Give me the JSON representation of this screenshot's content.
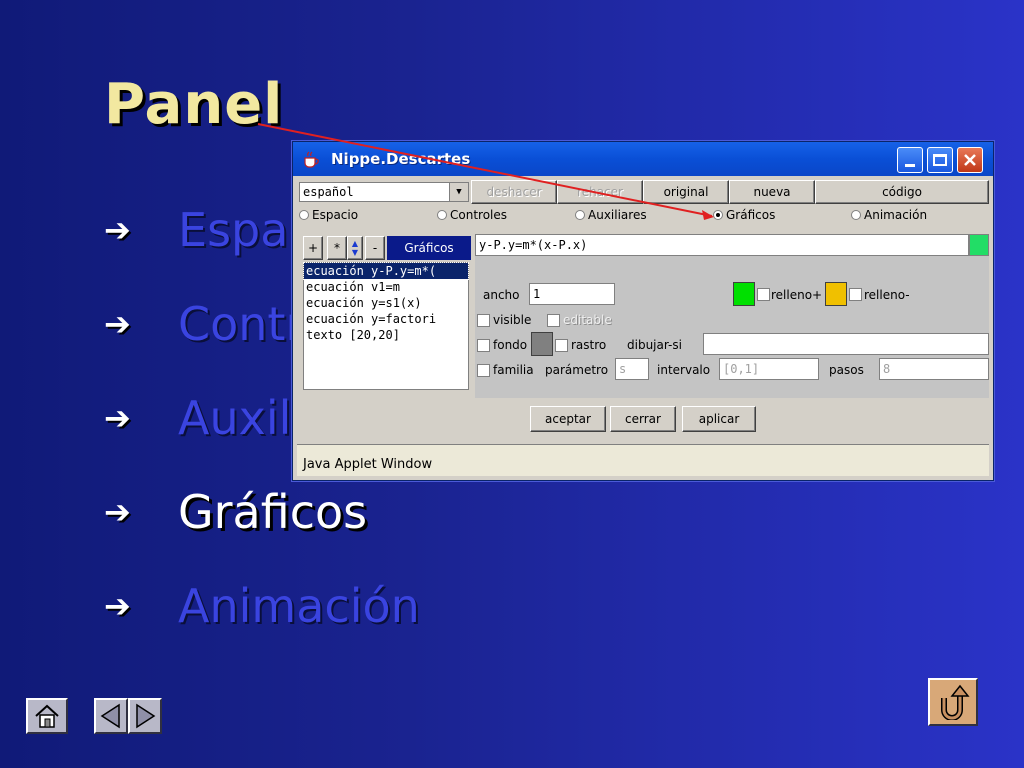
{
  "slide": {
    "title": "Panel",
    "bullets": [
      {
        "label": "Espacio",
        "active": false
      },
      {
        "label": "Controles",
        "active": false
      },
      {
        "label": "Auxiliares",
        "active": false
      },
      {
        "label": "Gráficos",
        "active": true
      },
      {
        "label": "Animación",
        "active": false
      }
    ],
    "arrow_glyph": "➔"
  },
  "applet": {
    "window_title": "Nippe.Descartes",
    "language": "español",
    "toolbar": {
      "undo": "deshacer",
      "redo": "rehacer",
      "original": "original",
      "new": "nueva",
      "code": "código"
    },
    "tabs": [
      {
        "label": "Espacio",
        "selected": false
      },
      {
        "label": "Controles",
        "selected": false
      },
      {
        "label": "Auxiliares",
        "selected": false
      },
      {
        "label": "Gráficos",
        "selected": true
      },
      {
        "label": "Animación",
        "selected": false
      }
    ],
    "list_buttons": {
      "add": "+",
      "dup": "*",
      "remove": "-"
    },
    "list_header": "Gráficos",
    "items": [
      "ecuación y-P.y=m*(",
      "ecuación v1=m",
      "ecuación y=s1(x)",
      "ecuación y=factori",
      "texto [20,20]"
    ],
    "selected_item_index": 0,
    "expression": "y-P.y=m*(x-P.x)",
    "expression_color": "#22dd66",
    "ancho_label": "ancho",
    "ancho_value": "1",
    "relleno_plus_label": "relleno+",
    "relleno_plus_color": "#00e000",
    "relleno_minus_label": "relleno-",
    "relleno_minus_color": "#f0c000",
    "visible_label": "visible",
    "editable_label": "editable",
    "fondo_label": "fondo",
    "fondo_color": "#808080",
    "rastro_label": "rastro",
    "dibujar_si_label": "dibujar-si",
    "dibujar_si_value": "",
    "familia_label": "familia",
    "parametro_label": "parámetro",
    "parametro_value": "s",
    "intervalo_label": "intervalo",
    "intervalo_value": "[0,1]",
    "pasos_label": "pasos",
    "pasos_value": "8",
    "accept": "aceptar",
    "close": "cerrar",
    "apply": "aplicar",
    "status": "Java Applet Window"
  },
  "nav": {
    "home_icon": "home-icon",
    "prev_icon": "prev-icon",
    "next_icon": "next-icon",
    "return_icon": "return-icon"
  },
  "colors": {
    "pointer": "#e02020",
    "title_text": "#f2e8a0",
    "bullet_inactive": "#3a44e0"
  }
}
